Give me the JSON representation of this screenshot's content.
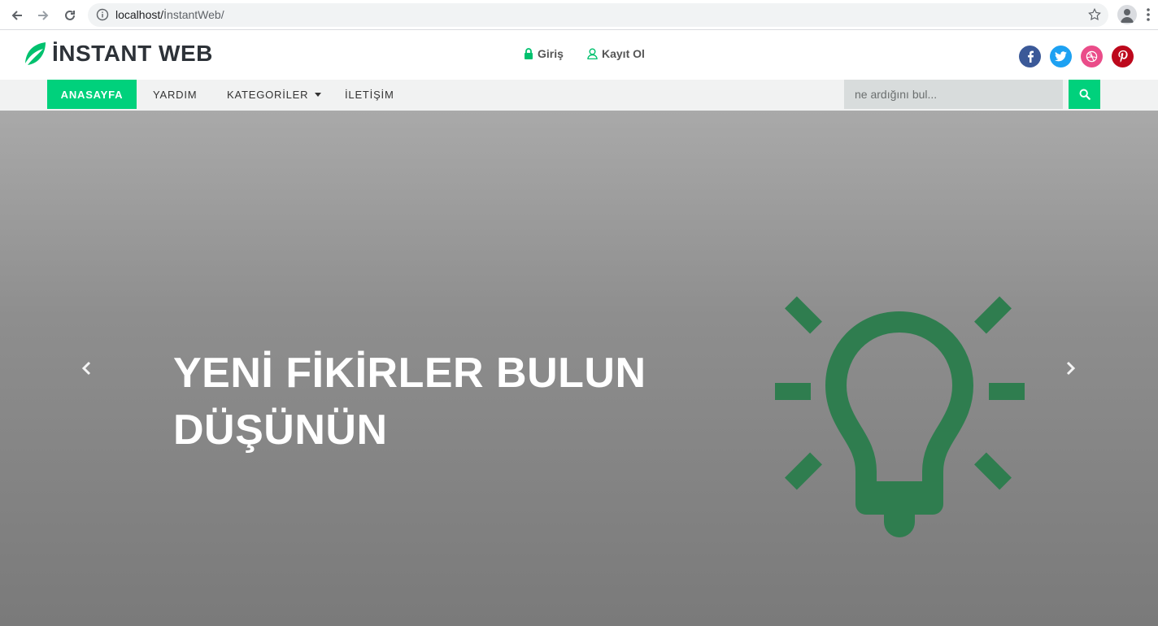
{
  "browser": {
    "url_host": "localhost/",
    "url_path": "İnstantWeb/"
  },
  "header": {
    "logo_text": "İNSTANT WEB",
    "login_label": "Giriş",
    "register_label": "Kayıt Ol",
    "social": [
      {
        "name": "facebook",
        "color": "#3b5998"
      },
      {
        "name": "twitter",
        "color": "#1da1f2"
      },
      {
        "name": "dribbble",
        "color": "#ea4c89"
      },
      {
        "name": "pinterest",
        "color": "#bd081c"
      }
    ]
  },
  "nav": {
    "items": [
      {
        "label": "ANASAYFA"
      },
      {
        "label": "YARDIM"
      },
      {
        "label": "KATEGORİLER"
      },
      {
        "label": "İLETİŞİM"
      }
    ],
    "search_placeholder": "ne ardığını bul..."
  },
  "hero": {
    "title_line1": "YENİ FİKİRLER BULUN",
    "title_line2": "DÜŞÜNÜN"
  },
  "colors": {
    "accent": "#00d17c",
    "bulb": "#2e7d4f"
  }
}
